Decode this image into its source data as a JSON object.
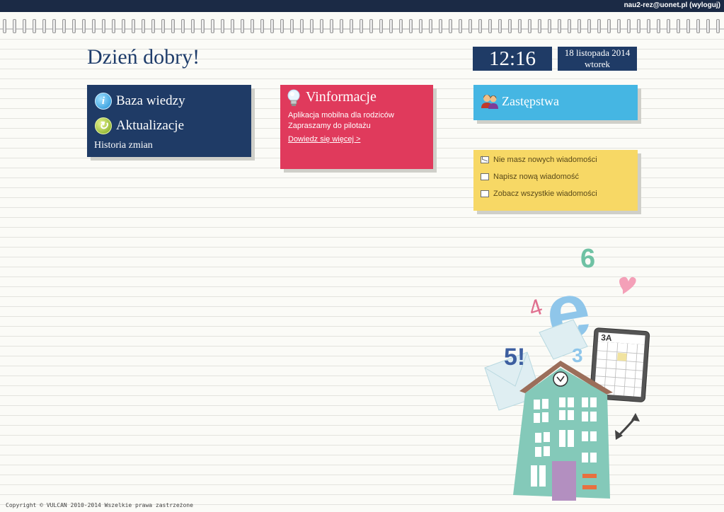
{
  "topbar": {
    "user": "nau2-rez@uonet.pl (wyloguj)"
  },
  "greeting": "Dzień dobry!",
  "clock": {
    "time": "12:16",
    "date": "18 listopada 2014",
    "weekday": "wtorek"
  },
  "knowledge_tile": {
    "items": [
      {
        "label": "Baza wiedzy",
        "icon": "info-icon"
      },
      {
        "label": "Aktualizacje",
        "icon": "refresh-icon"
      }
    ],
    "history": "Historia zmian",
    "color": "#1f3b66"
  },
  "vinfo_tile": {
    "title": "Vinformacje",
    "line1": "Aplikacja mobilna dla rodziców",
    "line2": "Zapraszamy do pilotażu",
    "link": "Dowiedz się więcej >",
    "color": "#e03a5c"
  },
  "substitutions_tile": {
    "label": "Zastępstwa",
    "icon": "people-icon",
    "color": "#45b6e3"
  },
  "messages_tile": {
    "items": [
      {
        "label": "Nie masz nowych wiadomości",
        "icon": "envelope-icon"
      },
      {
        "label": "Napisz nową wiadomość",
        "icon": "compose-icon"
      },
      {
        "label": "Zobacz wszystkie wiadomości",
        "icon": "inbox-icon"
      }
    ],
    "color": "#f7d865"
  },
  "illustration": {
    "numbers": [
      "6",
      "4",
      "5!",
      "3"
    ],
    "letter": "e",
    "board_label": "3A"
  },
  "footer": "Copyright © VULCAN 2010-2014 Wszelkie prawa zastrzeżone"
}
